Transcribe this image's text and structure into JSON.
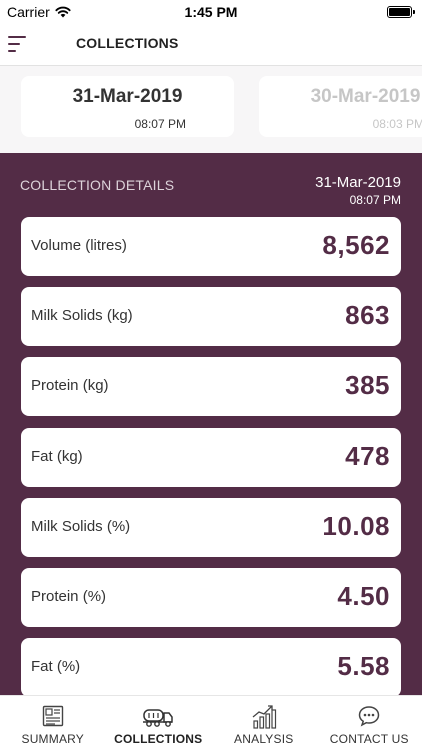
{
  "status_bar": {
    "carrier": "Carrier",
    "time": "1:45 PM"
  },
  "nav": {
    "title": "COLLECTIONS"
  },
  "date_strip": {
    "cards": [
      {
        "date": "31-Mar-2019",
        "time": "08:07 PM",
        "selected": true
      },
      {
        "date": "30-Mar-2019",
        "time": "08:03 PM",
        "selected": false
      }
    ]
  },
  "details": {
    "header": "COLLECTION DETAILS",
    "date": "31-Mar-2019",
    "time": "08:07 PM",
    "metrics": [
      {
        "label": "Volume (litres)",
        "value": "8,562"
      },
      {
        "label": "Milk Solids (kg)",
        "value": "863"
      },
      {
        "label": "Protein (kg)",
        "value": "385"
      },
      {
        "label": "Fat (kg)",
        "value": "478"
      },
      {
        "label": "Milk Solids (%)",
        "value": "10.08"
      },
      {
        "label": "Protein (%)",
        "value": "4.50"
      },
      {
        "label": "Fat (%)",
        "value": "5.58"
      }
    ]
  },
  "tabs": [
    {
      "label": "SUMMARY",
      "icon": "summary-icon",
      "active": false
    },
    {
      "label": "COLLECTIONS",
      "icon": "tanker-truck-icon",
      "active": true
    },
    {
      "label": "ANALYSIS",
      "icon": "analysis-chart-icon",
      "active": false
    },
    {
      "label": "CONTACT US",
      "icon": "chat-bubble-icon",
      "active": false
    }
  ],
  "colors": {
    "brand": "#532c46",
    "strip_background": "#f7f6f7",
    "inactive_text": "#c6c6c6"
  }
}
